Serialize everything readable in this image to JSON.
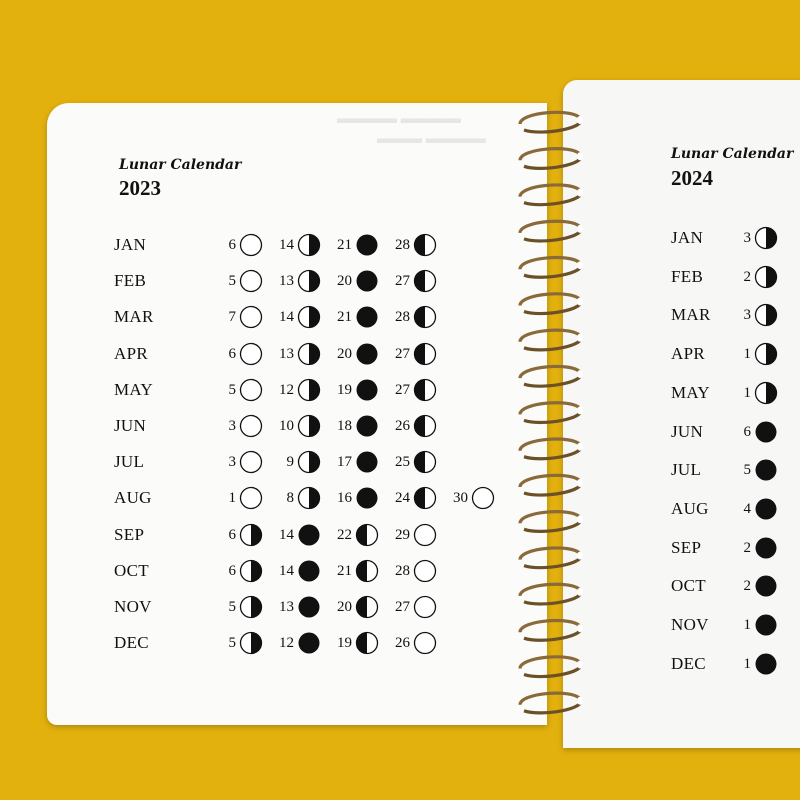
{
  "left": {
    "title": "Lunar Calendar",
    "year": "2023",
    "months": [
      {
        "month": "JAN",
        "phases": [
          {
            "day": "6",
            "phase": "full"
          },
          {
            "day": "14",
            "phase": "last-quarter"
          },
          {
            "day": "21",
            "phase": "new"
          },
          {
            "day": "28",
            "phase": "first-quarter"
          }
        ]
      },
      {
        "month": "FEB",
        "phases": [
          {
            "day": "5",
            "phase": "full"
          },
          {
            "day": "13",
            "phase": "last-quarter"
          },
          {
            "day": "20",
            "phase": "new"
          },
          {
            "day": "27",
            "phase": "first-quarter"
          }
        ]
      },
      {
        "month": "MAR",
        "phases": [
          {
            "day": "7",
            "phase": "full"
          },
          {
            "day": "14",
            "phase": "last-quarter"
          },
          {
            "day": "21",
            "phase": "new"
          },
          {
            "day": "28",
            "phase": "first-quarter"
          }
        ]
      },
      {
        "month": "APR",
        "phases": [
          {
            "day": "6",
            "phase": "full"
          },
          {
            "day": "13",
            "phase": "last-quarter"
          },
          {
            "day": "20",
            "phase": "new"
          },
          {
            "day": "27",
            "phase": "first-quarter"
          }
        ]
      },
      {
        "month": "MAY",
        "phases": [
          {
            "day": "5",
            "phase": "full"
          },
          {
            "day": "12",
            "phase": "last-quarter"
          },
          {
            "day": "19",
            "phase": "new"
          },
          {
            "day": "27",
            "phase": "first-quarter"
          }
        ]
      },
      {
        "month": "JUN",
        "phases": [
          {
            "day": "3",
            "phase": "full"
          },
          {
            "day": "10",
            "phase": "last-quarter"
          },
          {
            "day": "18",
            "phase": "new"
          },
          {
            "day": "26",
            "phase": "first-quarter"
          }
        ]
      },
      {
        "month": "JUL",
        "phases": [
          {
            "day": "3",
            "phase": "full"
          },
          {
            "day": "9",
            "phase": "last-quarter"
          },
          {
            "day": "17",
            "phase": "new"
          },
          {
            "day": "25",
            "phase": "first-quarter"
          }
        ]
      },
      {
        "month": "AUG",
        "phases": [
          {
            "day": "1",
            "phase": "full"
          },
          {
            "day": "8",
            "phase": "last-quarter"
          },
          {
            "day": "16",
            "phase": "new"
          },
          {
            "day": "24",
            "phase": "first-quarter"
          },
          {
            "day": "30",
            "phase": "full"
          }
        ]
      },
      {
        "month": "SEP",
        "phases": [
          {
            "day": "6",
            "phase": "last-quarter"
          },
          {
            "day": "14",
            "phase": "new"
          },
          {
            "day": "22",
            "phase": "first-quarter"
          },
          {
            "day": "29",
            "phase": "full"
          }
        ]
      },
      {
        "month": "OCT",
        "phases": [
          {
            "day": "6",
            "phase": "last-quarter"
          },
          {
            "day": "14",
            "phase": "new"
          },
          {
            "day": "21",
            "phase": "first-quarter"
          },
          {
            "day": "28",
            "phase": "full"
          }
        ]
      },
      {
        "month": "NOV",
        "phases": [
          {
            "day": "5",
            "phase": "last-quarter"
          },
          {
            "day": "13",
            "phase": "new"
          },
          {
            "day": "20",
            "phase": "first-quarter"
          },
          {
            "day": "27",
            "phase": "full"
          }
        ]
      },
      {
        "month": "DEC",
        "phases": [
          {
            "day": "5",
            "phase": "last-quarter"
          },
          {
            "day": "12",
            "phase": "new"
          },
          {
            "day": "19",
            "phase": "first-quarter"
          },
          {
            "day": "26",
            "phase": "full"
          }
        ]
      }
    ]
  },
  "right": {
    "title": "Lunar Calendar",
    "year": "2024",
    "months": [
      {
        "month": "JAN",
        "phases": [
          {
            "day": "3",
            "phase": "last-quarter"
          }
        ]
      },
      {
        "month": "FEB",
        "phases": [
          {
            "day": "2",
            "phase": "last-quarter"
          }
        ]
      },
      {
        "month": "MAR",
        "phases": [
          {
            "day": "3",
            "phase": "last-quarter"
          }
        ]
      },
      {
        "month": "APR",
        "phases": [
          {
            "day": "1",
            "phase": "last-quarter"
          }
        ]
      },
      {
        "month": "MAY",
        "phases": [
          {
            "day": "1",
            "phase": "last-quarter"
          }
        ]
      },
      {
        "month": "JUN",
        "phases": [
          {
            "day": "6",
            "phase": "new"
          }
        ]
      },
      {
        "month": "JUL",
        "phases": [
          {
            "day": "5",
            "phase": "new"
          }
        ]
      },
      {
        "month": "AUG",
        "phases": [
          {
            "day": "4",
            "phase": "new"
          }
        ]
      },
      {
        "month": "SEP",
        "phases": [
          {
            "day": "2",
            "phase": "new"
          }
        ]
      },
      {
        "month": "OCT",
        "phases": [
          {
            "day": "2",
            "phase": "new"
          }
        ]
      },
      {
        "month": "NOV",
        "phases": [
          {
            "day": "1",
            "phase": "new"
          }
        ]
      },
      {
        "month": "DEC",
        "phases": [
          {
            "day": "1",
            "phase": "new"
          }
        ]
      }
    ]
  },
  "colors": {
    "background": "#e3b10e",
    "page": "#fbfbf9",
    "ink": "#111111",
    "ring": "#8a6a3a"
  }
}
